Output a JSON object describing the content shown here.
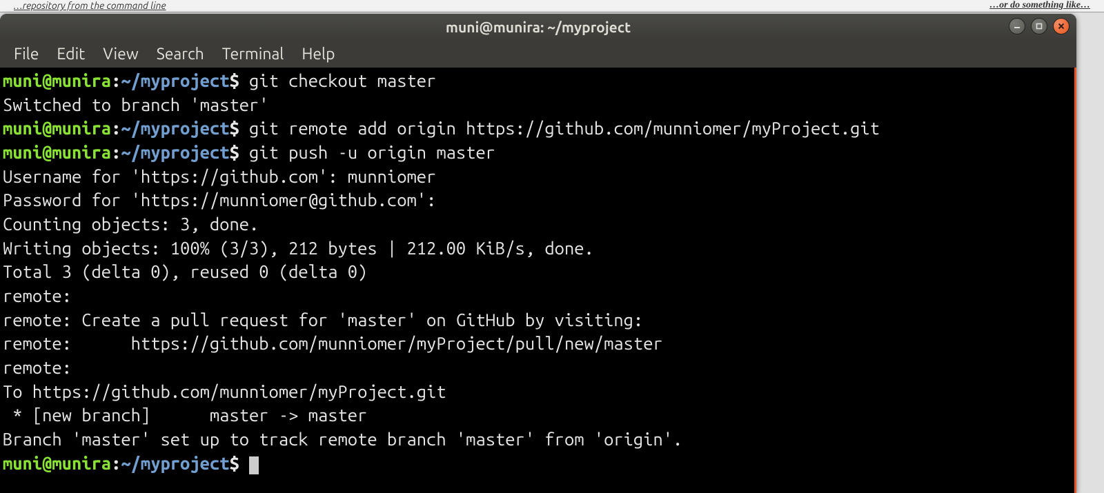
{
  "background": {
    "left_text": "…repository from the command line",
    "right_text": "…or do something like…"
  },
  "window": {
    "title": "muni@munira: ~/myproject"
  },
  "menubar": {
    "items": [
      "File",
      "Edit",
      "View",
      "Search",
      "Terminal",
      "Help"
    ]
  },
  "prompt": {
    "user_host": "muni@munira",
    "path": "~/myproject",
    "dollar": "$"
  },
  "commands": {
    "c1": "git checkout master",
    "c2": "git remote add origin https://github.com/munniomer/myProject.git",
    "c3": "git push -u origin master"
  },
  "output": {
    "l1": "Switched to branch 'master'",
    "l2": "Username for 'https://github.com': munniomer",
    "l3": "Password for 'https://munniomer@github.com':",
    "l4": "Counting objects: 3, done.",
    "l5": "Writing objects: 100% (3/3), 212 bytes | 212.00 KiB/s, done.",
    "l6": "Total 3 (delta 0), reused 0 (delta 0)",
    "l7": "remote: ",
    "l8": "remote: Create a pull request for 'master' on GitHub by visiting:",
    "l9": "remote:      https://github.com/munniomer/myProject/pull/new/master",
    "l10": "remote: ",
    "l11": "To https://github.com/munniomer/myProject.git",
    "l12": " * [new branch]      master -> master",
    "l13": "Branch 'master' set up to track remote branch 'master' from 'origin'."
  }
}
